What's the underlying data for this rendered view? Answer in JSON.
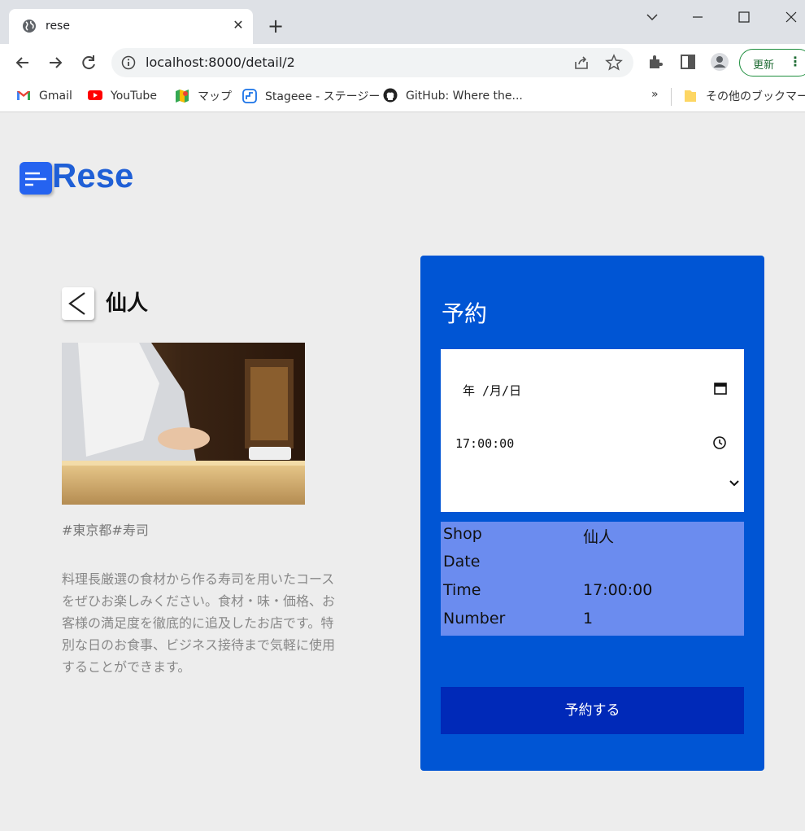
{
  "browser": {
    "tab_title": "rese",
    "tab_close": "✕",
    "new_tab": "+",
    "url": "localhost:8000/detail/2",
    "update_label": "更新",
    "window_controls": [
      "minimize",
      "maximize",
      "close"
    ],
    "bookmarks": [
      {
        "label": "Gmail",
        "icon": "gmail-icon"
      },
      {
        "label": "YouTube",
        "icon": "youtube-icon"
      },
      {
        "label": "マップ",
        "icon": "maps-icon"
      },
      {
        "label": "Stageee - ステージー",
        "icon": "stageee-icon"
      },
      {
        "label": "GitHub: Where the...",
        "icon": "github-icon"
      }
    ],
    "bookmarks_overflow": "»",
    "other_bookmarks": "その他のブックマーク"
  },
  "app": {
    "logo_text": "Rese"
  },
  "shop": {
    "name": "仙人",
    "tags": "#東京都#寿司",
    "description": "料理長厳選の食材から作る寿司を用いたコースをぜひお楽しみください。食材・味・価格、お客様の満足度を徹底的に追及したお店です。特別な日のお食事、ビジネス接待まで気軽に使用することができます。"
  },
  "reservation": {
    "title": "予約",
    "date_placeholder": "年 /月/日",
    "time_value": "17:00:00",
    "summary": {
      "shop_label": "Shop",
      "shop_value": "仙人",
      "date_label": "Date",
      "date_value": "",
      "time_label": "Time",
      "time_value": "17:00:00",
      "number_label": "Number",
      "number_value": "1"
    },
    "submit_label": "予約する"
  },
  "colors": {
    "card_bg": "#0055d4",
    "summary_bg": "#6b8cef",
    "button_bg": "#0029b8",
    "logo": "#1f5fd6"
  }
}
